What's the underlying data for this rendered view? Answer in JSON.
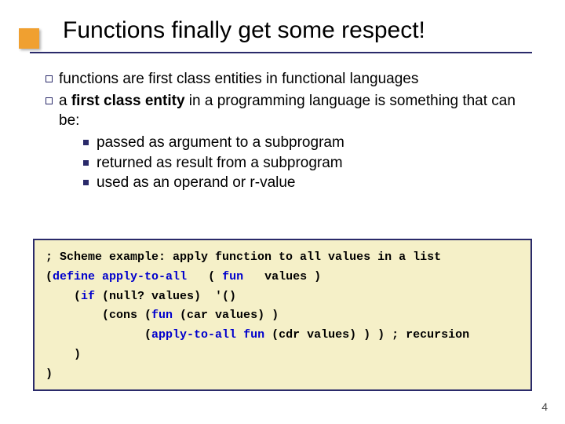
{
  "title": "Functions finally get some respect!",
  "bullets": {
    "q0": "functions are first class entities in functional languages",
    "q1_pre": "a ",
    "q1_bold": "first class entity",
    "q1_post": " in a programming language is something that can be:"
  },
  "sub": {
    "n0": "passed as argument to a subprogram",
    "n1": "returned as result from a subprogram",
    "n2": "used as an operand or r-value"
  },
  "code": {
    "l0": "; Scheme example: apply function to all values in a list",
    "l1a": "(",
    "l1b": "define",
    "l1c": " ",
    "l1d": "apply-to-all",
    "l1e": "   ( ",
    "l1f": "fun",
    "l1g": "   values )",
    "l2a": "    (",
    "l2b": "if",
    "l2c": " (null? values)  '()",
    "l3a": "        (cons (",
    "l3b": "fun",
    "l3c": " (car values) )",
    "l4a": "              (",
    "l4b": "apply-to-all",
    "l4c": " ",
    "l4d": "fun",
    "l4e": " (cdr values) ) ) ; recursion",
    "l5": "    )",
    "l6": ")"
  },
  "page_number": "4"
}
